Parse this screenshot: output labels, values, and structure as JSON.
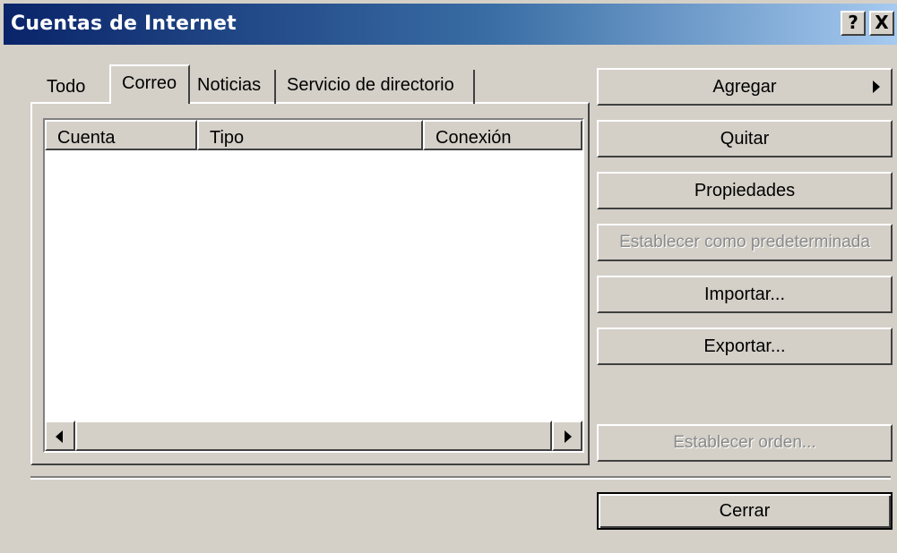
{
  "window": {
    "title": "Cuentas de Internet",
    "help_label": "?",
    "close_label": "X"
  },
  "tabs": [
    {
      "label": "Todo"
    },
    {
      "label": "Correo",
      "selected": true
    },
    {
      "label": "Noticias"
    },
    {
      "label": "Servicio de directorio"
    }
  ],
  "list": {
    "columns": [
      "Cuenta",
      "Tipo",
      "Conexión"
    ],
    "rows": []
  },
  "buttons": {
    "agregar": "Agregar",
    "quitar": "Quitar",
    "propiedades": "Propiedades",
    "establecer_predeterminada": "Establecer como predeterminada",
    "importar": "Importar...",
    "exportar": "Exportar...",
    "establecer_orden": "Establecer orden...",
    "cerrar": "Cerrar"
  },
  "colors": {
    "titlebar_start": "#0a246a",
    "titlebar_end": "#a6caf0",
    "face": "#d4d0c8"
  },
  "icons": [
    "help-icon",
    "close-icon",
    "submenu-arrow-icon",
    "scroll-left-icon",
    "scroll-right-icon"
  ]
}
